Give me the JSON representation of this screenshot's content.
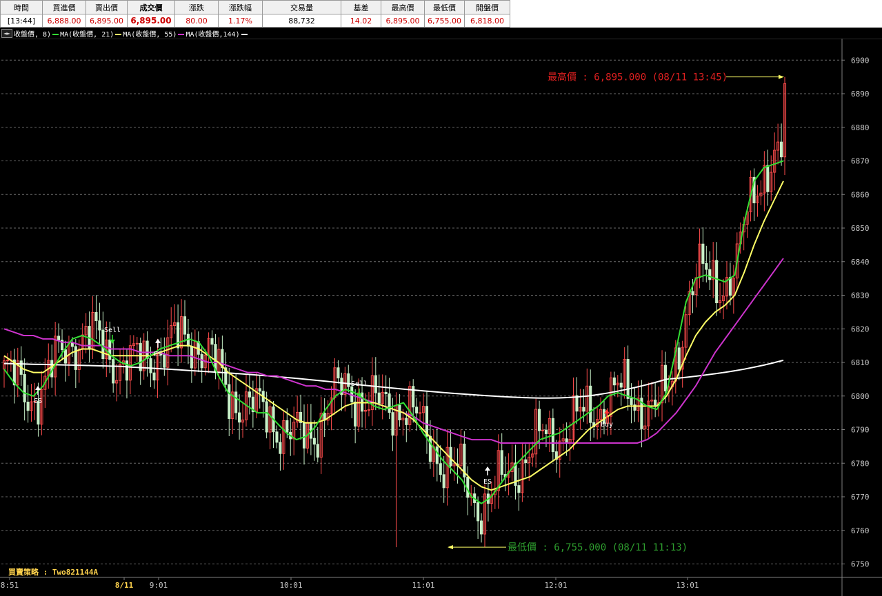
{
  "quote_table": {
    "headers": [
      "時間",
      "買進價",
      "賣出價",
      "成交價",
      "漲跌",
      "漲跌幅",
      "交易量",
      "基差",
      "最高價",
      "最低價",
      "開盤價"
    ],
    "values": [
      "[13:44]",
      "6,888.00",
      "6,895.00",
      "6,895.00",
      "80.00",
      "1.17%",
      "88,732",
      "14.02",
      "6,895.00",
      "6,755.00",
      "6,818.00"
    ],
    "value_colors": [
      "#000000",
      "#cc0000",
      "#cc0000",
      "#cc0000",
      "#cc0000",
      "#cc0000",
      "#000000",
      "#cc0000",
      "#cc0000",
      "#cc0000",
      "#cc0000"
    ]
  },
  "legend": {
    "nav_icon": "left-right-arrow-icon",
    "items": [
      {
        "label": "收盤價,  8)",
        "color": "#ffffff"
      },
      {
        "label": "MA(收盤價, 21)",
        "color": "#33dd33"
      },
      {
        "label": "MA(收盤價, 55)",
        "color": "#ffff66"
      },
      {
        "label": "MA(收盤價,144)",
        "color": "#cc33cc"
      }
    ],
    "tail_color": "#ffffff"
  },
  "annotations": {
    "high": "最高價 : 6,895.000 (08/11 13:45)",
    "low": "最低價 : 6,755.000 (08/11 11:13)",
    "high_color": "#e02020",
    "low_color": "#2e9e2e"
  },
  "strategy_label": "買賣策略 : Two821144A",
  "chart_data": {
    "type": "candlestick",
    "y_ticks": [
      6750,
      6760,
      6770,
      6780,
      6790,
      6800,
      6810,
      6820,
      6830,
      6840,
      6850,
      6860,
      6870,
      6880,
      6890,
      6900
    ],
    "ylim": [
      6746,
      6906
    ],
    "x_ticks": [
      "8:51",
      "8/11",
      "9:01",
      "10:01",
      "11:01",
      "12:01",
      "13:01"
    ],
    "session_high": 6895,
    "session_low": 6755,
    "colors": {
      "up": "#ff4c4c",
      "down": "#c8f0c8"
    },
    "signals": [
      {
        "label": "ES",
        "type": "up"
      },
      {
        "label": "Sell",
        "type": "down"
      },
      {
        "label": "ES",
        "type": "up"
      },
      {
        "label": "Sell",
        "type": "down"
      },
      {
        "label": "ES",
        "type": "up"
      },
      {
        "label": "Buy",
        "type": "buy"
      }
    ],
    "ma8": [
      6808,
      6804,
      6801,
      6800,
      6803,
      6808,
      6813,
      6817,
      6818,
      6817,
      6815,
      6812,
      6810,
      6809,
      6810,
      6812,
      6814,
      6815,
      6816,
      6817,
      6816,
      6812,
      6806,
      6801,
      6799,
      6797,
      6795,
      6795,
      6792,
      6789,
      6787,
      6788,
      6791,
      6796,
      6800,
      6802,
      6801,
      6799,
      6797,
      6796,
      6797,
      6798,
      6794,
      6789,
      6785,
      6781,
      6778,
      6775,
      6770,
      6768,
      6770,
      6774,
      6778,
      6781,
      6784,
      6787,
      6788,
      6789,
      6791,
      6793,
      6795,
      6797,
      6800,
      6801,
      6800,
      6799,
      6797,
      6796,
      6801,
      6814,
      6828,
      6835,
      6836,
      6835,
      6834,
      6836,
      6852,
      6864,
      6868,
      6869,
      6870
    ],
    "ma21": [
      6812,
      6810,
      6808,
      6807,
      6807,
      6809,
      6811,
      6813,
      6814,
      6814,
      6813,
      6812,
      6812,
      6812,
      6812,
      6812,
      6813,
      6814,
      6815,
      6815,
      6814,
      6812,
      6810,
      6807,
      6805,
      6803,
      6801,
      6799,
      6797,
      6795,
      6793,
      6792,
      6792,
      6793,
      6795,
      6797,
      6798,
      6798,
      6798,
      6797,
      6796,
      6795,
      6793,
      6790,
      6787,
      6784,
      6781,
      6778,
      6775,
      6773,
      6772,
      6773,
      6774,
      6775,
      6776,
      6778,
      6780,
      6782,
      6784,
      6787,
      6790,
      6792,
      6794,
      6796,
      6797,
      6797,
      6797,
      6797,
      6800,
      6805,
      6812,
      6818,
      6822,
      6825,
      6827,
      6830,
      6837,
      6845,
      6852,
      6858,
      6864
    ],
    "ma55": [
      6820,
      6819,
      6818,
      6818,
      6817,
      6817,
      6816,
      6816,
      6815,
      6815,
      6815,
      6814,
      6814,
      6814,
      6813,
      6813,
      6813,
      6812,
      6812,
      6812,
      6811,
      6810,
      6810,
      6809,
      6808,
      6807,
      6807,
      6806,
      6806,
      6805,
      6804,
      6803,
      6803,
      6802,
      6802,
      6801,
      6800,
      6799,
      6798,
      6797,
      6796,
      6795,
      6794,
      6792,
      6791,
      6790,
      6789,
      6788,
      6787,
      6787,
      6787,
      6786,
      6786,
      6786,
      6786,
      6786,
      6786,
      6786,
      6786,
      6786,
      6786,
      6786,
      6786,
      6786,
      6786,
      6786,
      6787,
      6789,
      6792,
      6795,
      6799,
      6803,
      6808,
      6813,
      6817,
      6821,
      6825,
      6829,
      6833,
      6837,
      6841
    ]
  }
}
